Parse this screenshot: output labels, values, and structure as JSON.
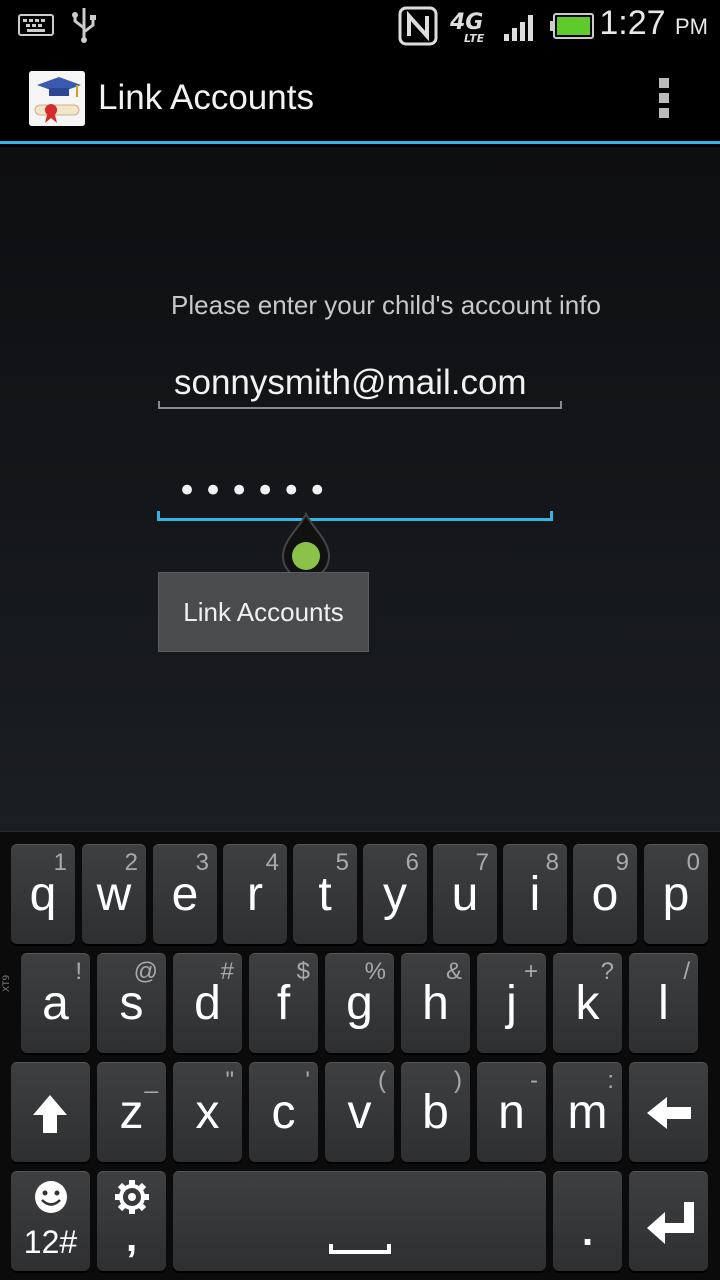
{
  "status_bar": {
    "time": "1:27",
    "ampm": "PM",
    "network": "4G",
    "network_sub": "LTE"
  },
  "action_bar": {
    "title": "Link Accounts"
  },
  "form": {
    "prompt": "Please enter your child's account info",
    "email_value": "sonnysmith@mail.com",
    "password_mask": "••••••",
    "submit_label": "Link Accounts"
  },
  "keyboard": {
    "label_xt9": "XT9",
    "row1": [
      {
        "main": "q",
        "hint": "1"
      },
      {
        "main": "w",
        "hint": "2"
      },
      {
        "main": "e",
        "hint": "3"
      },
      {
        "main": "r",
        "hint": "4"
      },
      {
        "main": "t",
        "hint": "5"
      },
      {
        "main": "y",
        "hint": "6"
      },
      {
        "main": "u",
        "hint": "7"
      },
      {
        "main": "i",
        "hint": "8"
      },
      {
        "main": "o",
        "hint": "9"
      },
      {
        "main": "p",
        "hint": "0"
      }
    ],
    "row2": [
      {
        "main": "a",
        "hint": "!"
      },
      {
        "main": "s",
        "hint": "@"
      },
      {
        "main": "d",
        "hint": "#"
      },
      {
        "main": "f",
        "hint": "$"
      },
      {
        "main": "g",
        "hint": "%"
      },
      {
        "main": "h",
        "hint": "&"
      },
      {
        "main": "j",
        "hint": "+"
      },
      {
        "main": "k",
        "hint": "?"
      },
      {
        "main": "l",
        "hint": "/"
      }
    ],
    "row3": [
      {
        "main": "z",
        "hint": "_"
      },
      {
        "main": "x",
        "hint": "\""
      },
      {
        "main": "c",
        "hint": "'"
      },
      {
        "main": "v",
        "hint": "("
      },
      {
        "main": "b",
        "hint": ")"
      },
      {
        "main": "n",
        "hint": "-"
      },
      {
        "main": "m",
        "hint": ":"
      }
    ],
    "symbols_label": "12#",
    "comma_label": ",",
    "period_label": "."
  },
  "colors": {
    "accent": "#33b5e5",
    "handle_green": "#8bc34a"
  }
}
